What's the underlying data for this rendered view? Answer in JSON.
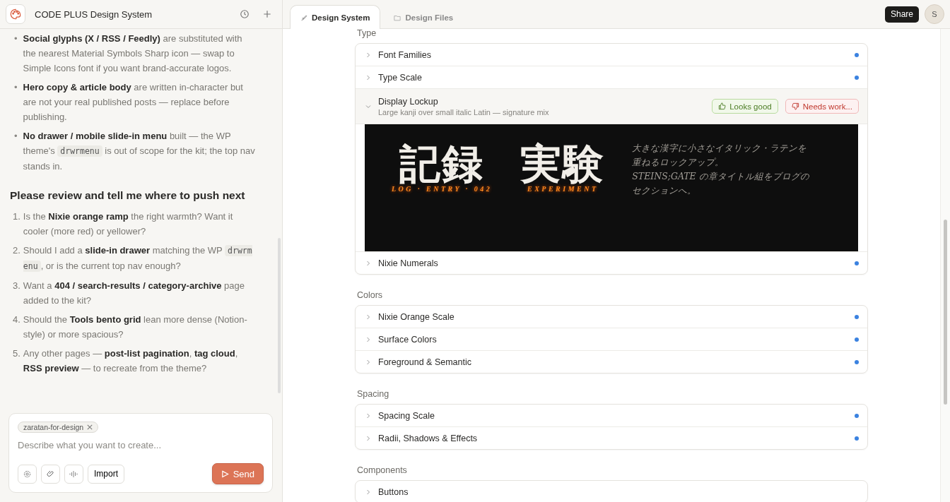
{
  "sidebar": {
    "title": "CODE PLUS Design System",
    "bullets": [
      {
        "marker": "•",
        "parts": [
          {
            "kind": "text",
            "text": "**Social glyphs (X / RSS / Feedly)** are substituted with the nearest Material Symbols Sharp icon — swap to Simple Icons font if you want brand-accurate logos."
          }
        ]
      },
      {
        "marker": "•",
        "parts": [
          {
            "kind": "text",
            "text": "**Hero copy & article body** are written in-character but are not your real published posts — replace before publishing."
          }
        ]
      },
      {
        "marker": "•",
        "parts": [
          {
            "kind": "text",
            "text": "**No drawer / mobile slide-in menu** built — the WP theme's "
          },
          {
            "kind": "code",
            "text": "drwrmenu"
          },
          {
            "kind": "text",
            "text": " is out of scope for the kit; the top nav stands in."
          }
        ]
      }
    ],
    "heading": "Please review and tell me where to push next",
    "questions": [
      {
        "number": "1.",
        "parts": [
          {
            "kind": "text",
            "text": "Is the **Nixie orange ramp** the right warmth? Want it cooler (more red) or yellower?"
          }
        ]
      },
      {
        "number": "2.",
        "parts": [
          {
            "kind": "text",
            "text": "Should I add a **slide-in drawer** matching the WP "
          },
          {
            "kind": "code",
            "text": "drwrmenu"
          },
          {
            "kind": "text",
            "text": ", or is the current top nav enough?"
          }
        ]
      },
      {
        "number": "3.",
        "parts": [
          {
            "kind": "text",
            "text": "Want a **404 / search-results / category-archive** page added to the kit?"
          }
        ]
      },
      {
        "number": "4.",
        "parts": [
          {
            "kind": "text",
            "text": "Should the **Tools bento grid** lean more dense (Notion-style) or more spacious?"
          }
        ]
      },
      {
        "number": "5.",
        "parts": [
          {
            "kind": "text",
            "text": "Any other pages — **post-list pagination**, **tag cloud**, **RSS preview** — to recreate from the theme?"
          }
        ]
      }
    ],
    "composer": {
      "chip": "zaratan-for-design",
      "placeholder": "Describe what you want to create...",
      "import": "Import",
      "send": "Send"
    }
  },
  "tabs": [
    {
      "label": "Design System",
      "selected": true
    },
    {
      "label": "Design Files",
      "selected": false
    }
  ],
  "share": "Share",
  "avatar": "S",
  "sections": [
    {
      "label": "Type",
      "rows": [
        {
          "title": "Font Families",
          "expanded": false,
          "dot": true
        },
        {
          "title": "Type Scale",
          "expanded": false,
          "dot": true
        },
        {
          "title": "Display Lockup",
          "expanded": true,
          "dot": false,
          "subtitle": "Large kanji over small italic Latin — signature mix",
          "approve": "Looks good",
          "reject": "Needs work...",
          "preview": {
            "lockups": [
              {
                "kanji": "記録",
                "latin": "LOG · ENTRY · 042"
              },
              {
                "kanji": "実験",
                "latin": "EXPERIMENT"
              }
            ],
            "lines": [
              "大きな漢字に小さなイタリック・ラテンを",
              "重ねるロックアップ。",
              "STEINS;GATE の章タイトル組をブログの",
              "セクションへ。"
            ]
          }
        },
        {
          "title": "Nixie Numerals",
          "expanded": false,
          "dot": true
        }
      ]
    },
    {
      "label": "Colors",
      "rows": [
        {
          "title": "Nixie Orange Scale",
          "expanded": false,
          "dot": true
        },
        {
          "title": "Surface Colors",
          "expanded": false,
          "dot": true
        },
        {
          "title": "Foreground & Semantic",
          "expanded": false,
          "dot": true
        }
      ]
    },
    {
      "label": "Spacing",
      "rows": [
        {
          "title": "Spacing Scale",
          "expanded": false,
          "dot": true
        },
        {
          "title": "Radii, Shadows & Effects",
          "expanded": false,
          "dot": true
        }
      ]
    },
    {
      "label": "Components",
      "rows": [
        {
          "title": "Buttons",
          "expanded": false,
          "dot": false
        }
      ]
    }
  ]
}
